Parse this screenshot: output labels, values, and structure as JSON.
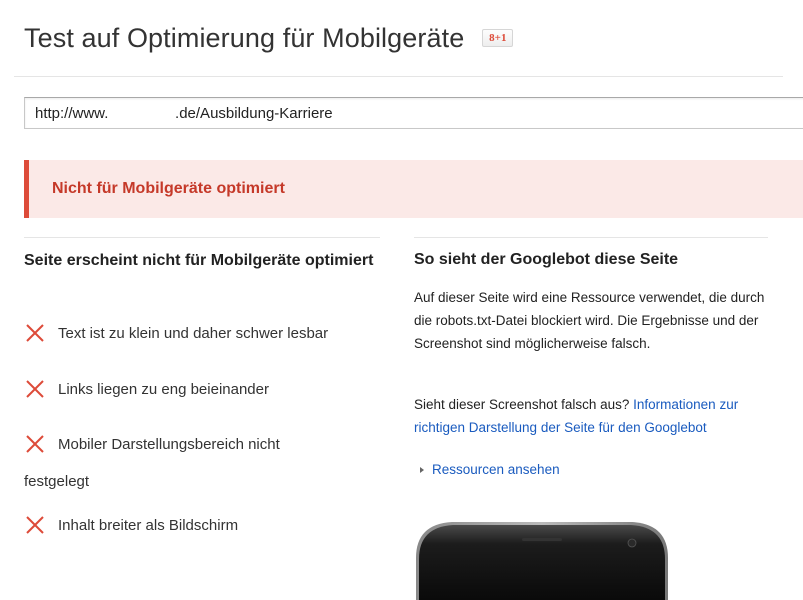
{
  "header": {
    "title": "Test auf Optimierung für Mobilgeräte",
    "gplus_label": "8+1"
  },
  "url_input": {
    "value": "http://www.                .de/Ausbildung-Karriere"
  },
  "alert": {
    "text": "Nicht für Mobilgeräte optimiert",
    "color": "#dd4b39",
    "background": "#fbe9e7"
  },
  "left": {
    "heading": "Seite erscheint nicht für Mobilgeräte optimiert",
    "issues": [
      {
        "label": "Text ist zu klein und daher schwer lesbar",
        "icon": "cross-icon"
      },
      {
        "label": "Links liegen zu eng beieinander",
        "icon": "cross-icon"
      },
      {
        "label": "Mobiler Darstellungsbereich nicht",
        "continuation": "festgelegt",
        "icon": "cross-icon"
      },
      {
        "label": "Inhalt breiter als Bildschirm",
        "icon": "cross-icon"
      }
    ]
  },
  "right": {
    "heading": "So sieht der Googlebot diese Seite",
    "description": "Auf dieser Seite wird eine Ressource verwendet, die durch die robots.txt-Datei blockiert wird. Die Ergebnisse und der Screenshot sind möglicherweise falsch.",
    "question": "Sieht dieser Screenshot falsch aus?",
    "link": "Informationen zur richtigen Darstellung der Seite für den Googlebot",
    "resources_label": "Ressourcen ansehen"
  },
  "colors": {
    "link": "#1a5bbf",
    "error_icon": "#dd4b39"
  }
}
